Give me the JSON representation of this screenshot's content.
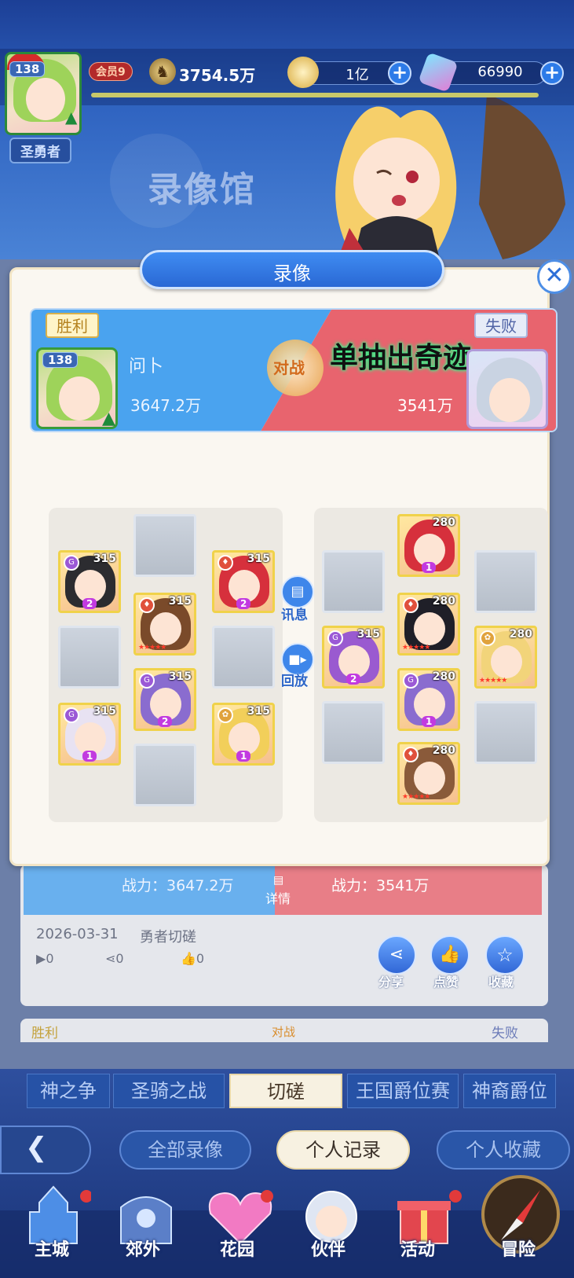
{
  "header": {
    "player_level": "138",
    "player_title": "圣勇者",
    "vip_badge": "会员9",
    "power": "3754.5万",
    "gold": "1亿",
    "gems": "66990",
    "background_title": "录像馆"
  },
  "dialog": {
    "title": "录像",
    "result_left": "胜利",
    "result_right": "失败",
    "vs_label": "对战",
    "left_player": {
      "level": "138",
      "name": "问卜",
      "power": "3647.2万"
    },
    "right_player": {
      "name": "单抽出奇迹",
      "power": "3541万"
    },
    "side_buttons": {
      "info": "讯息",
      "replay": "回放"
    },
    "left_heroes": [
      {
        "level": "315",
        "rank": "2",
        "stars": ""
      },
      {
        "level": "315",
        "rank": "",
        "stars": "★★★★★"
      },
      {
        "level": "315",
        "rank": "2",
        "stars": ""
      },
      {
        "level": "315",
        "rank": "2",
        "stars": ""
      },
      {
        "level": "315",
        "rank": "1",
        "stars": ""
      },
      {
        "level": "315",
        "rank": "1",
        "stars": ""
      }
    ],
    "right_heroes": [
      {
        "level": "280",
        "rank": "1",
        "stars": ""
      },
      {
        "level": "315",
        "rank": "2",
        "stars": ""
      },
      {
        "level": "280",
        "rank": "",
        "stars": "★★★★★"
      },
      {
        "level": "280",
        "rank": "",
        "stars": "★★★★★"
      },
      {
        "level": "280",
        "rank": "1",
        "stars": ""
      },
      {
        "level": "280",
        "rank": "",
        "stars": "★★★★★"
      }
    ]
  },
  "behind": {
    "left_power": "战力：3647.2万",
    "right_power": "战力：3541万",
    "details": "详情",
    "date": "2026-03-31",
    "mode": "勇者切磋",
    "views": "0",
    "shares": "0",
    "likes": "0",
    "share_label": "分享",
    "like_label": "点赞",
    "fav_label": "收藏",
    "next_left": "胜利",
    "next_vs": "对战",
    "next_right": "失败"
  },
  "tabs": [
    "神之争",
    "圣骑之战",
    "切磋",
    "王国爵位赛",
    "神裔爵位"
  ],
  "filters": [
    "全部录像",
    "个人记录",
    "个人收藏"
  ],
  "nav": [
    "主城",
    "郊外",
    "花园",
    "伙伴",
    "活动",
    "冒险"
  ],
  "colors": {
    "win_blue": "#4aa3ef",
    "lose_red": "#e8646e",
    "accent_gold": "#f0d24a"
  }
}
